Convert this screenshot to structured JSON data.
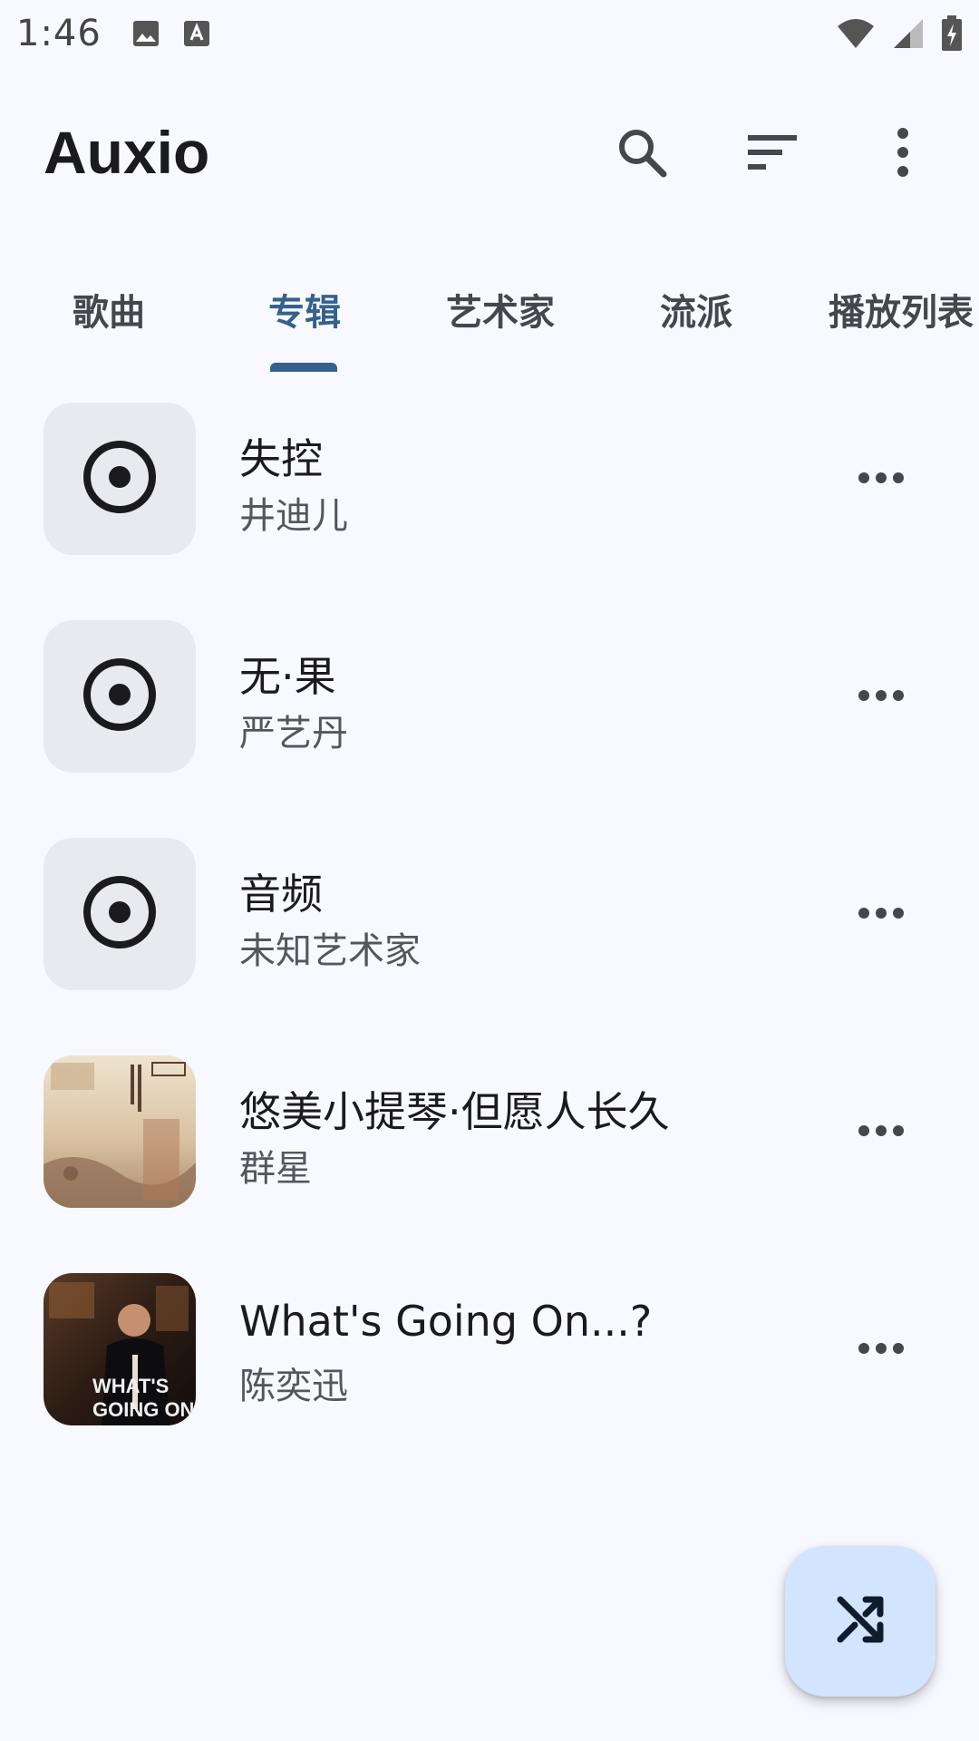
{
  "status_bar": {
    "time": "1:46",
    "icons": [
      "image-icon",
      "font-icon",
      "wifi-icon",
      "signal-icon",
      "battery-charging-icon"
    ]
  },
  "app_bar": {
    "title": "Auxio",
    "actions": [
      "search-icon",
      "sort-icon",
      "more-vert-icon"
    ]
  },
  "tabs": {
    "items": [
      {
        "label": "歌曲"
      },
      {
        "label": "专辑"
      },
      {
        "label": "艺术家"
      },
      {
        "label": "流派"
      },
      {
        "label": "播放列表"
      }
    ],
    "selected": "专辑"
  },
  "albums": [
    {
      "title": "失控",
      "artist": "井迪儿",
      "cover": "disc-placeholder-icon"
    },
    {
      "title": "无·果",
      "artist": "严艺丹",
      "cover": "disc-placeholder-icon"
    },
    {
      "title": "音频",
      "artist": "未知艺术家",
      "cover": "disc-placeholder-icon"
    },
    {
      "title": "悠美小提琴·但愿人长久",
      "artist": "群星",
      "cover": "album-art"
    },
    {
      "title": "What's Going On...?",
      "artist": "陈奕迅",
      "cover": "album-art",
      "cover_text": "WHAT'S GOING ON...?"
    }
  ],
  "fab": {
    "icon": "shuffle-icon"
  },
  "colors": {
    "background": "#f8f9ff",
    "accent": "#36618e",
    "fab_background": "#d3e4ff",
    "cover_placeholder": "#e9eaf0"
  }
}
